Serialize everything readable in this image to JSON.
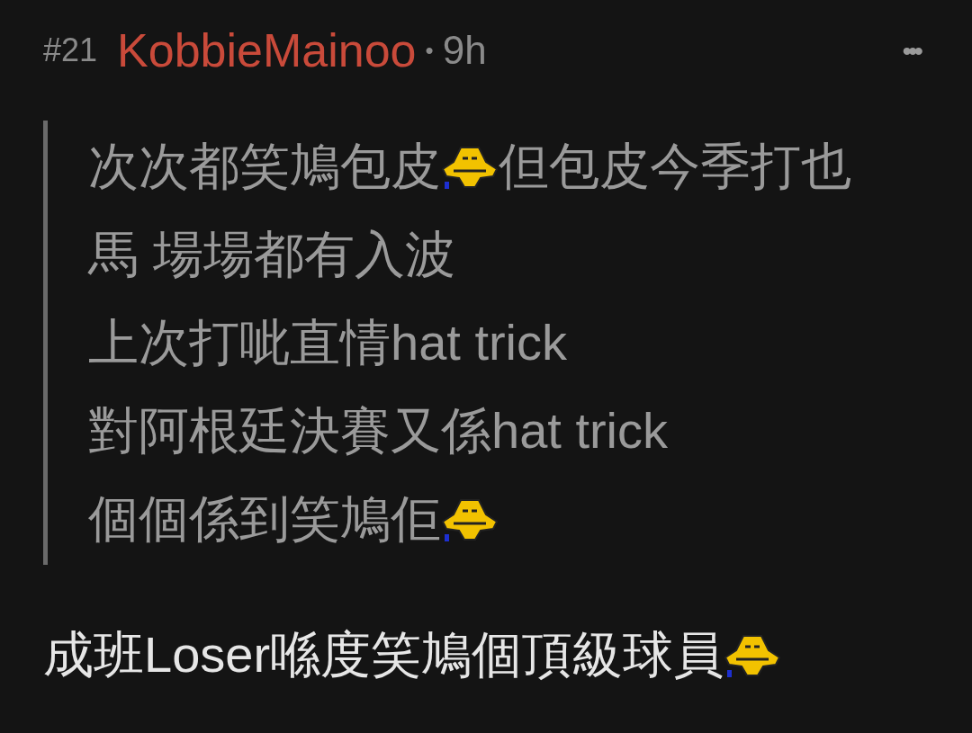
{
  "post": {
    "number": "#21",
    "username": "KobbieMainoo",
    "separator": "•",
    "time": "9h",
    "more": "•••"
  },
  "quote_lines": [
    [
      {
        "kind": "text",
        "text": "次次都笑鳩包皮"
      },
      {
        "kind": "emoticon"
      },
      {
        "kind": "text",
        "text": "但包皮今季打也"
      }
    ],
    [
      {
        "kind": "text",
        "text": "馬 場場都有入波"
      }
    ],
    [
      {
        "kind": "text",
        "text": "上次打呲直情hat trick"
      }
    ],
    [
      {
        "kind": "text",
        "text": "對阿根廷決賽又係hat trick"
      }
    ],
    [
      {
        "kind": "text",
        "text": "個個係到笑鳩佢"
      },
      {
        "kind": "emoticon"
      }
    ]
  ],
  "reply": [
    {
      "kind": "text",
      "text": "成班Loser喺度笑鳩個頂級球員"
    },
    {
      "kind": "emoticon"
    }
  ]
}
